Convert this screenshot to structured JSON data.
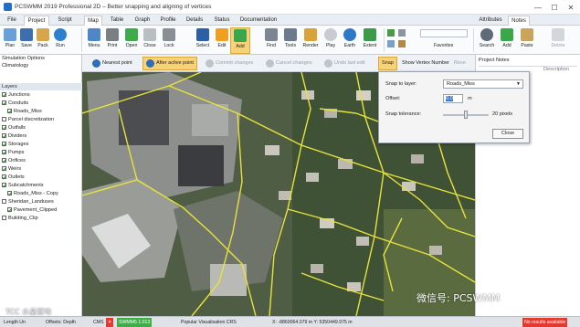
{
  "window": {
    "title": "PCSWMM 2019 Professional 2D  –  Better snapping and aligning of vertices",
    "controls": [
      "—",
      "☐",
      "✕"
    ]
  },
  "tabs_left": [
    "File",
    "Project",
    "Script"
  ],
  "tabs_main": [
    "Map",
    "Table",
    "Graph",
    "Profile",
    "Details",
    "Status",
    "Documentation"
  ],
  "tabs_right": [
    "Attributes",
    "Notes"
  ],
  "ribbon_left": [
    "Plan",
    "Save",
    "Pack",
    "Run"
  ],
  "ribbon_main": [
    "Menu",
    "Print",
    "Open",
    "Close",
    "Lock",
    "Select",
    "Edit",
    "Add",
    "Find",
    "Tools",
    "Render",
    "Play",
    "Earth",
    "Extent"
  ],
  "ribbon_favorites_label": "Favorites",
  "ribbon_right": [
    "Search",
    "Add",
    "Paste",
    "Delete"
  ],
  "toolbar2": {
    "nearest_point": "Nearest point",
    "after_active_point": "After active point",
    "commit_changes": "Commit changes",
    "cancel_changes": "Cancel changes",
    "undo_last_edit": "Undo last edit",
    "snap": "Snap",
    "show_vertex_number": "Show Vertex Number",
    "reverse": "Reve"
  },
  "left_panel": {
    "top_items": [
      "Simulation Options",
      "Climatology"
    ],
    "layers_header": "Layers",
    "layers": [
      {
        "label": "Junctions",
        "checked": true,
        "indent": 0
      },
      {
        "label": "Conduits",
        "checked": true,
        "indent": 0
      },
      {
        "label": "Roads_Miss",
        "checked": true,
        "indent": 1
      },
      {
        "label": "Parcel discretization",
        "checked": false,
        "indent": 0
      },
      {
        "label": "Outfalls",
        "checked": true,
        "indent": 0
      },
      {
        "label": "Dividers",
        "checked": true,
        "indent": 0
      },
      {
        "label": "Storages",
        "checked": true,
        "indent": 0
      },
      {
        "label": "Pumps",
        "checked": true,
        "indent": 0
      },
      {
        "label": "Orifices",
        "checked": true,
        "indent": 0
      },
      {
        "label": "Weirs",
        "checked": true,
        "indent": 0
      },
      {
        "label": "Outlets",
        "checked": true,
        "indent": 0
      },
      {
        "label": "Subcatchments",
        "checked": true,
        "indent": 0
      },
      {
        "label": "Roads_Miss - Copy",
        "checked": true,
        "indent": 1
      },
      {
        "label": "Sheridan_Landuses",
        "checked": false,
        "indent": 0
      },
      {
        "label": "Pavement_Clipped",
        "checked": true,
        "indent": 1
      },
      {
        "label": "Building_Clip",
        "checked": false,
        "indent": 0
      }
    ]
  },
  "right_panel": {
    "project_notes": "Project Notes",
    "description": "Description"
  },
  "snap_dialog": {
    "snap_to_layer_label": "Snap to layer:",
    "snap_to_layer_value": "Roads_Miss",
    "offset_label": "Offset:",
    "offset_value": "0.0",
    "offset_unit": "m",
    "tolerance_label": "Snap tolerance:",
    "tolerance_value": "20 pixels",
    "tolerance_slider_fraction": 0.5,
    "close_button": "Close"
  },
  "status_bar": {
    "length_units": "Length Un",
    "offsets": "Offsets: Depth",
    "cms": "CMS",
    "engine": "SWMM5 1.013",
    "crs": "Popular Visualisation CRS",
    "coords": "X: -8860064.079 m  Y: 5350449.975 m",
    "results": "No results available"
  },
  "watermark": "微信号: PCSWMM",
  "watermark_left": "TCC 水晶营地",
  "colors": {
    "accent_orange": "#f7d27a",
    "road_lines": "#e8e23a",
    "status_red": "#e03b2e",
    "status_green": "#3fae49"
  }
}
